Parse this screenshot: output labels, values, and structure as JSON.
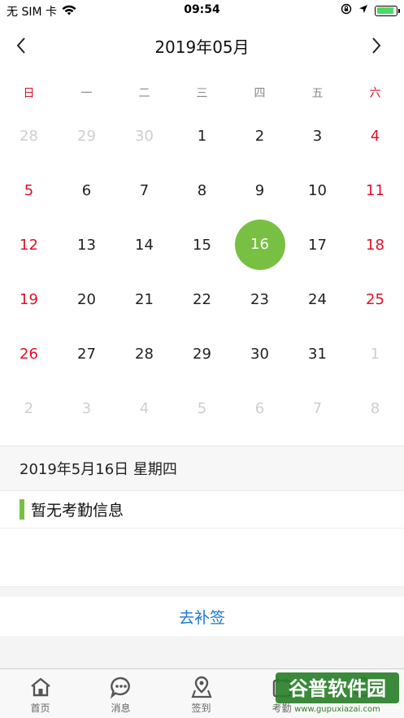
{
  "status_bar": {
    "carrier": "无 SIM 卡",
    "time": "09:54"
  },
  "calendar": {
    "title": "2019年05月",
    "weekdays": [
      "日",
      "一",
      "二",
      "三",
      "四",
      "五",
      "六"
    ],
    "selected_day": "16",
    "accent_color": "#78c043",
    "weekend_color": "#e0102a",
    "weeks": [
      [
        "28",
        "29",
        "30",
        "1",
        "2",
        "3",
        "4"
      ],
      [
        "5",
        "6",
        "7",
        "8",
        "9",
        "10",
        "11"
      ],
      [
        "12",
        "13",
        "14",
        "15",
        "16",
        "17",
        "18"
      ],
      [
        "19",
        "20",
        "21",
        "22",
        "23",
        "24",
        "25"
      ],
      [
        "26",
        "27",
        "28",
        "29",
        "30",
        "31",
        "1"
      ],
      [
        "2",
        "3",
        "4",
        "5",
        "6",
        "7",
        "8"
      ]
    ]
  },
  "detail": {
    "date_label": "2019年5月16日 星期四",
    "empty_text": "暂无考勤信息",
    "make_up_label": "去补签"
  },
  "tabbar": {
    "items": [
      {
        "label": "首页",
        "icon": "home-icon"
      },
      {
        "label": "消息",
        "icon": "message-icon"
      },
      {
        "label": "签到",
        "icon": "location-icon"
      },
      {
        "label": "考勤",
        "icon": "calendar-icon"
      },
      {
        "label": "",
        "icon": "user-icon"
      }
    ]
  },
  "watermark": {
    "brand": "谷普软件园",
    "url": "www.gupuxiazai.com"
  }
}
